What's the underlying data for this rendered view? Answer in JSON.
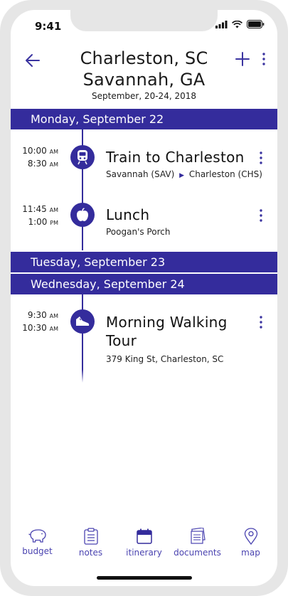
{
  "status": {
    "time": "9:41"
  },
  "header": {
    "title_line1": "Charleston, SC",
    "title_line2": "Savannah, GA",
    "dates": "September, 20-24, 2018"
  },
  "days": [
    {
      "label": "Monday, September 22"
    },
    {
      "label": "Tuesday, September 23"
    },
    {
      "label": "Wednesday, September 24"
    }
  ],
  "events": [
    {
      "start_time": "10:00",
      "start_ampm": "AM",
      "end_time": "8:30",
      "end_ampm": "AM",
      "icon": "train-icon",
      "title": "Train to Charleston",
      "from": "Savannah (SAV)",
      "to": "Charleston (CHS)"
    },
    {
      "start_time": "11:45",
      "start_ampm": "AM",
      "end_time": "1:00",
      "end_ampm": "PM",
      "icon": "apple-icon",
      "title": "Lunch",
      "subtitle": "Poogan's Porch"
    },
    {
      "start_time": "9:30",
      "start_ampm": "AM",
      "end_time": "10:30",
      "end_ampm": "AM",
      "icon": "sneaker-icon",
      "title_line1": "Morning Walking",
      "title_line2": "Tour",
      "subtitle": "379 King St, Charleston, SC"
    }
  ],
  "tabs": [
    {
      "label": "budget",
      "icon": "piggy-bank-icon"
    },
    {
      "label": "notes",
      "icon": "clipboard-icon"
    },
    {
      "label": "itinerary",
      "icon": "calendar-icon"
    },
    {
      "label": "documents",
      "icon": "documents-icon"
    },
    {
      "label": "map",
      "icon": "map-pin-icon"
    }
  ],
  "colors": {
    "accent": "#342c9c",
    "tab": "#4a43b0"
  }
}
